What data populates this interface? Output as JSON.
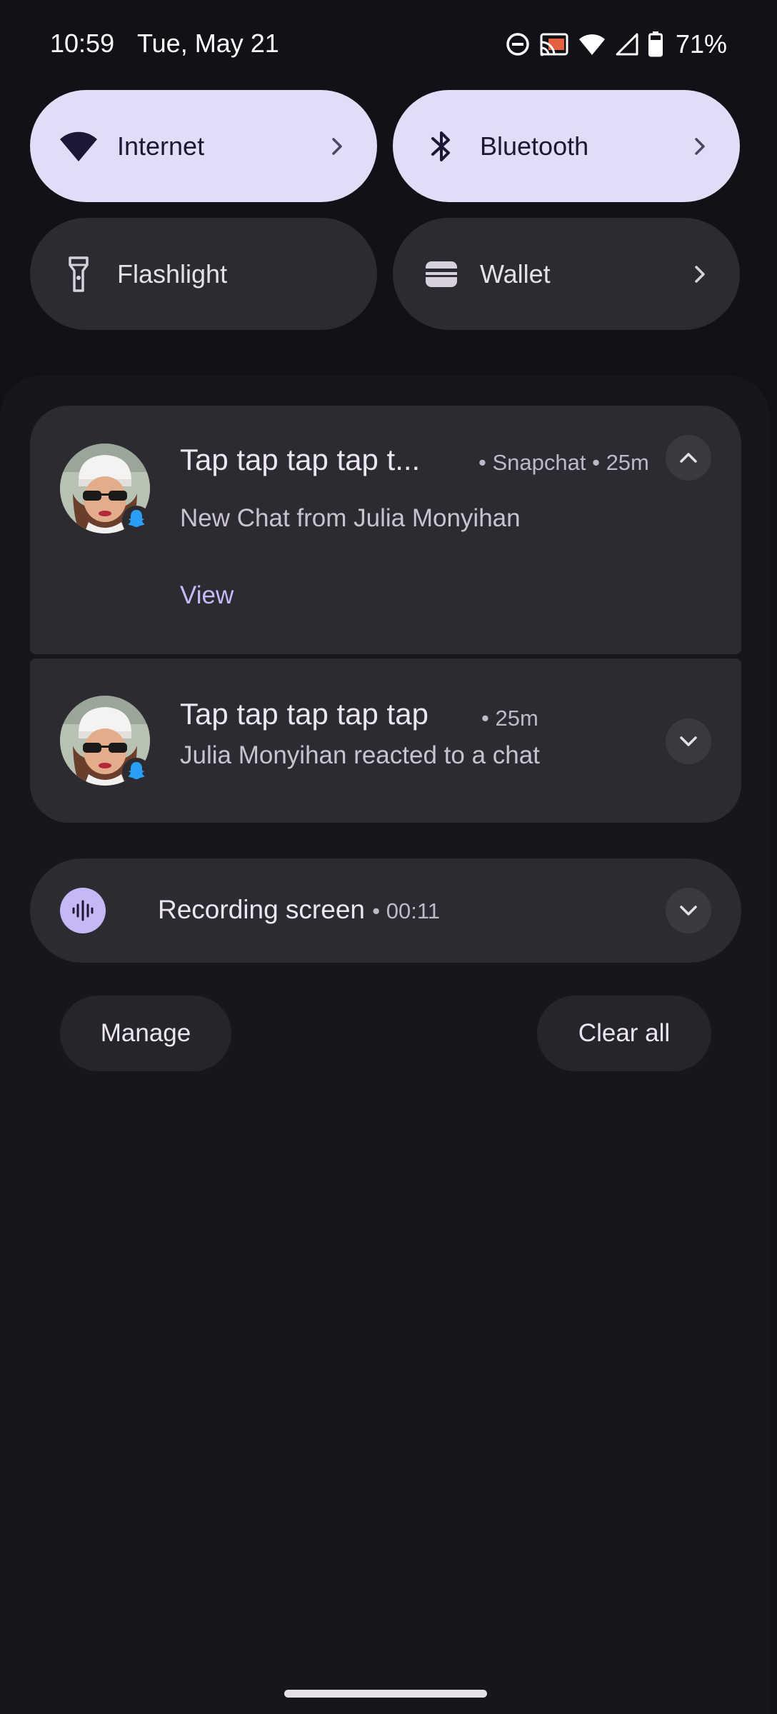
{
  "status_bar": {
    "time": "10:59",
    "date": "Tue, May 21",
    "icons": [
      "do-not-disturb-icon",
      "cast-icon",
      "wifi-icon",
      "cellular-signal-icon",
      "battery-icon"
    ],
    "battery": "71%"
  },
  "quick_tiles": [
    {
      "label": "Internet",
      "icon": "wifi-icon",
      "active": true,
      "has_chevron": true
    },
    {
      "label": "Bluetooth",
      "icon": "bluetooth-icon",
      "active": true,
      "has_chevron": true
    },
    {
      "label": "Flashlight",
      "icon": "flashlight-icon",
      "active": false,
      "has_chevron": false
    },
    {
      "label": "Wallet",
      "icon": "wallet-icon",
      "active": false,
      "has_chevron": true
    }
  ],
  "notifications": [
    {
      "title": "Tap tap tap tap t...",
      "app": "Snapchat",
      "time": "25m",
      "body": "New Chat from Julia Monyihan",
      "action": "View",
      "expanded": true
    },
    {
      "title": "Tap tap tap tap tap",
      "time": "25m",
      "body": "Julia Monyihan reacted to a chat",
      "expanded": false
    }
  ],
  "recording": {
    "title": "Recording screen",
    "elapsed": "00:11"
  },
  "footer": {
    "manage_label": "Manage",
    "clear_all_label": "Clear all"
  },
  "colors": {
    "background": "#121117",
    "active_tile": "#e3dcf7",
    "inactive_tile": "#2c2b31",
    "accent": "#c8b9f8",
    "snapchat_badge": "#2a9df4"
  }
}
